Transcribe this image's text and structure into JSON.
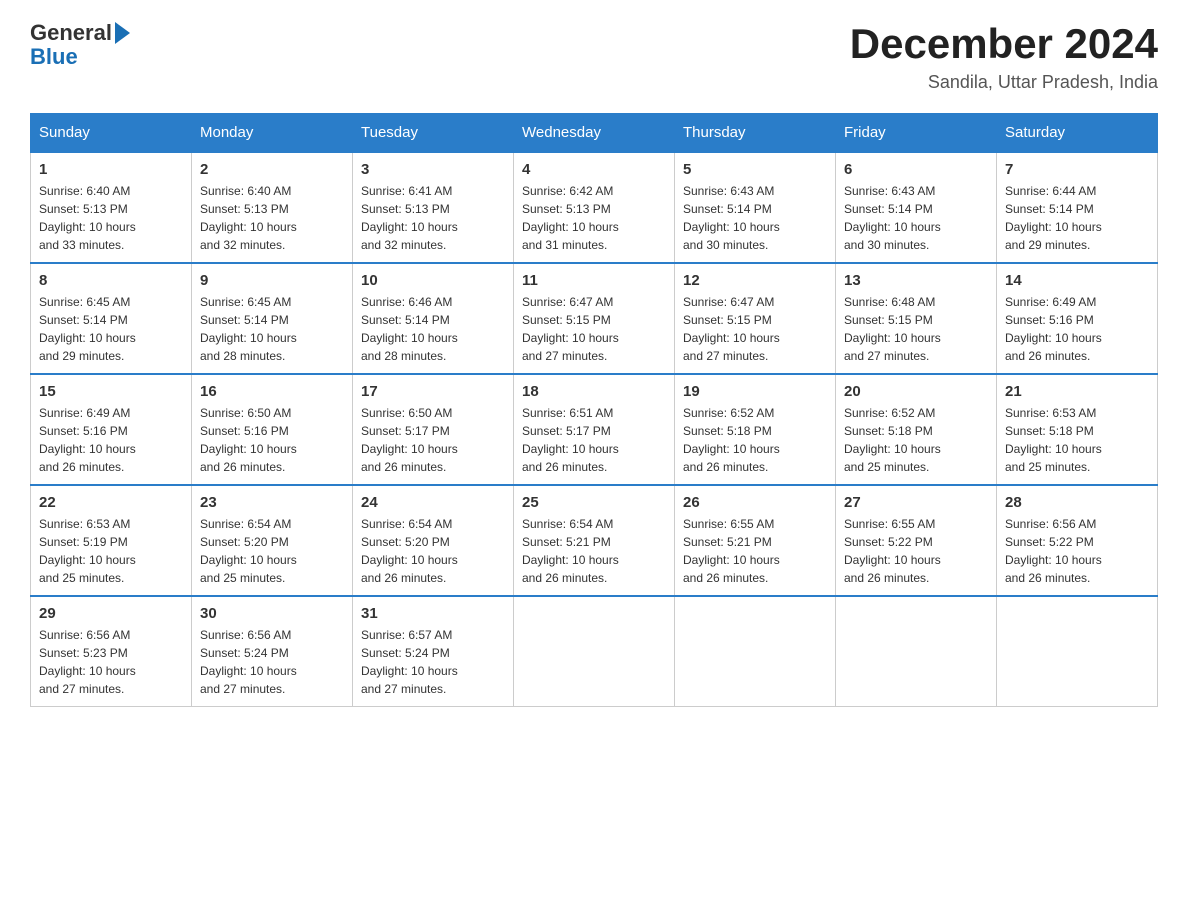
{
  "header": {
    "logo_general": "General",
    "logo_blue": "Blue",
    "month_title": "December 2024",
    "location": "Sandila, Uttar Pradesh, India"
  },
  "weekdays": [
    "Sunday",
    "Monday",
    "Tuesday",
    "Wednesday",
    "Thursday",
    "Friday",
    "Saturday"
  ],
  "weeks": [
    [
      {
        "day": "1",
        "sunrise": "6:40 AM",
        "sunset": "5:13 PM",
        "daylight": "10 hours and 33 minutes."
      },
      {
        "day": "2",
        "sunrise": "6:40 AM",
        "sunset": "5:13 PM",
        "daylight": "10 hours and 32 minutes."
      },
      {
        "day": "3",
        "sunrise": "6:41 AM",
        "sunset": "5:13 PM",
        "daylight": "10 hours and 32 minutes."
      },
      {
        "day": "4",
        "sunrise": "6:42 AM",
        "sunset": "5:13 PM",
        "daylight": "10 hours and 31 minutes."
      },
      {
        "day": "5",
        "sunrise": "6:43 AM",
        "sunset": "5:14 PM",
        "daylight": "10 hours and 30 minutes."
      },
      {
        "day": "6",
        "sunrise": "6:43 AM",
        "sunset": "5:14 PM",
        "daylight": "10 hours and 30 minutes."
      },
      {
        "day": "7",
        "sunrise": "6:44 AM",
        "sunset": "5:14 PM",
        "daylight": "10 hours and 29 minutes."
      }
    ],
    [
      {
        "day": "8",
        "sunrise": "6:45 AM",
        "sunset": "5:14 PM",
        "daylight": "10 hours and 29 minutes."
      },
      {
        "day": "9",
        "sunrise": "6:45 AM",
        "sunset": "5:14 PM",
        "daylight": "10 hours and 28 minutes."
      },
      {
        "day": "10",
        "sunrise": "6:46 AM",
        "sunset": "5:14 PM",
        "daylight": "10 hours and 28 minutes."
      },
      {
        "day": "11",
        "sunrise": "6:47 AM",
        "sunset": "5:15 PM",
        "daylight": "10 hours and 27 minutes."
      },
      {
        "day": "12",
        "sunrise": "6:47 AM",
        "sunset": "5:15 PM",
        "daylight": "10 hours and 27 minutes."
      },
      {
        "day": "13",
        "sunrise": "6:48 AM",
        "sunset": "5:15 PM",
        "daylight": "10 hours and 27 minutes."
      },
      {
        "day": "14",
        "sunrise": "6:49 AM",
        "sunset": "5:16 PM",
        "daylight": "10 hours and 26 minutes."
      }
    ],
    [
      {
        "day": "15",
        "sunrise": "6:49 AM",
        "sunset": "5:16 PM",
        "daylight": "10 hours and 26 minutes."
      },
      {
        "day": "16",
        "sunrise": "6:50 AM",
        "sunset": "5:16 PM",
        "daylight": "10 hours and 26 minutes."
      },
      {
        "day": "17",
        "sunrise": "6:50 AM",
        "sunset": "5:17 PM",
        "daylight": "10 hours and 26 minutes."
      },
      {
        "day": "18",
        "sunrise": "6:51 AM",
        "sunset": "5:17 PM",
        "daylight": "10 hours and 26 minutes."
      },
      {
        "day": "19",
        "sunrise": "6:52 AM",
        "sunset": "5:18 PM",
        "daylight": "10 hours and 26 minutes."
      },
      {
        "day": "20",
        "sunrise": "6:52 AM",
        "sunset": "5:18 PM",
        "daylight": "10 hours and 25 minutes."
      },
      {
        "day": "21",
        "sunrise": "6:53 AM",
        "sunset": "5:18 PM",
        "daylight": "10 hours and 25 minutes."
      }
    ],
    [
      {
        "day": "22",
        "sunrise": "6:53 AM",
        "sunset": "5:19 PM",
        "daylight": "10 hours and 25 minutes."
      },
      {
        "day": "23",
        "sunrise": "6:54 AM",
        "sunset": "5:20 PM",
        "daylight": "10 hours and 25 minutes."
      },
      {
        "day": "24",
        "sunrise": "6:54 AM",
        "sunset": "5:20 PM",
        "daylight": "10 hours and 26 minutes."
      },
      {
        "day": "25",
        "sunrise": "6:54 AM",
        "sunset": "5:21 PM",
        "daylight": "10 hours and 26 minutes."
      },
      {
        "day": "26",
        "sunrise": "6:55 AM",
        "sunset": "5:21 PM",
        "daylight": "10 hours and 26 minutes."
      },
      {
        "day": "27",
        "sunrise": "6:55 AM",
        "sunset": "5:22 PM",
        "daylight": "10 hours and 26 minutes."
      },
      {
        "day": "28",
        "sunrise": "6:56 AM",
        "sunset": "5:22 PM",
        "daylight": "10 hours and 26 minutes."
      }
    ],
    [
      {
        "day": "29",
        "sunrise": "6:56 AM",
        "sunset": "5:23 PM",
        "daylight": "10 hours and 27 minutes."
      },
      {
        "day": "30",
        "sunrise": "6:56 AM",
        "sunset": "5:24 PM",
        "daylight": "10 hours and 27 minutes."
      },
      {
        "day": "31",
        "sunrise": "6:57 AM",
        "sunset": "5:24 PM",
        "daylight": "10 hours and 27 minutes."
      },
      null,
      null,
      null,
      null
    ]
  ],
  "labels": {
    "sunrise": "Sunrise:",
    "sunset": "Sunset:",
    "daylight": "Daylight:"
  }
}
